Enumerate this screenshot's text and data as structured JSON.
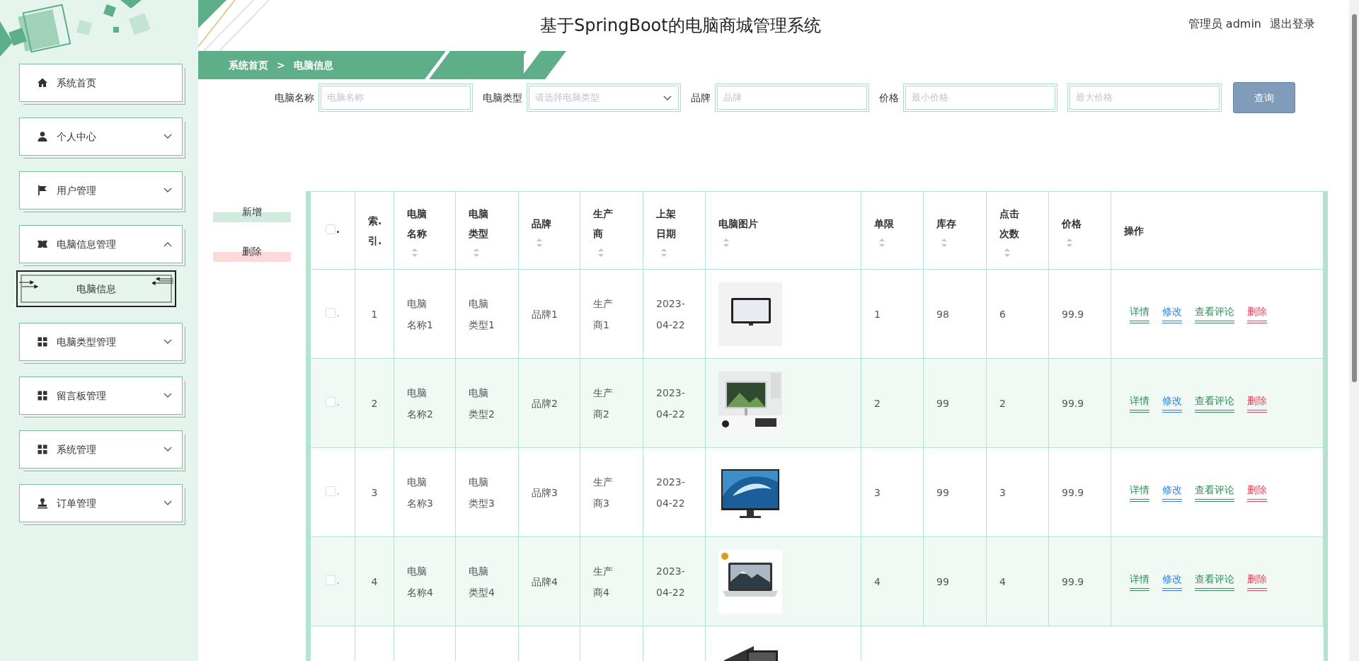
{
  "header": {
    "title": "基于SpringBoot的电脑商城管理系统",
    "user": "管理员 admin",
    "logout": "退出登录"
  },
  "sidebar": {
    "items": [
      {
        "label": "系统首页"
      },
      {
        "label": "个人中心",
        "expanded": false
      },
      {
        "label": "用户管理",
        "expanded": false
      },
      {
        "label": "电脑信息管理",
        "expanded": true,
        "children": [
          {
            "label": "电脑信息",
            "selected": true
          }
        ]
      },
      {
        "label": "电脑类型管理",
        "expanded": false
      },
      {
        "label": "留言板管理",
        "expanded": false
      },
      {
        "label": "系统管理",
        "expanded": false
      },
      {
        "label": "订单管理",
        "expanded": false
      }
    ]
  },
  "breadcrumb": [
    "系统首页",
    ">",
    "电脑信息"
  ],
  "search": {
    "fields": [
      {
        "label": "电脑名称",
        "placeholder": "电脑名称",
        "kind": "text"
      },
      {
        "label": "电脑类型",
        "placeholder": "请选择电脑类型",
        "kind": "select"
      },
      {
        "label": "品牌",
        "placeholder": "品牌",
        "kind": "text"
      },
      {
        "label": "价格",
        "placeholder": "最小价格",
        "kind": "text"
      },
      {
        "placeholder": "最大价格",
        "kind": "text"
      }
    ],
    "button": "查询"
  },
  "actions": [
    {
      "label": "新增",
      "kind": "add"
    },
    {
      "label": "删除",
      "kind": "delete"
    }
  ],
  "table": {
    "checkbox_mark": ".",
    "all_checked": false,
    "columns": [
      {
        "label": "索.引.",
        "sortable": false
      },
      {
        "label": "电脑名称",
        "sortable": true
      },
      {
        "label": "电脑类型",
        "sortable": true
      },
      {
        "label": "品牌",
        "sortable": true
      },
      {
        "label": "生产商",
        "sortable": true
      },
      {
        "label": "上架日期",
        "sortable": true
      },
      {
        "label": "电脑图片",
        "sortable": true
      },
      {
        "label": "单限",
        "sortable": true
      },
      {
        "label": "库存",
        "sortable": true
      },
      {
        "label": "点击次数",
        "sortable": true
      },
      {
        "label": "价格",
        "sortable": true
      },
      {
        "label": "操作",
        "sortable": false
      }
    ],
    "rows": [
      {
        "checked": false,
        "mark": ".",
        "cells": [
          "1",
          "电脑名称1",
          "电脑类型1",
          "品牌1",
          "生产商1",
          "2023-04-22",
          {
            "kind": "picture"
          },
          "1",
          "98",
          "6",
          "99.9"
        ],
        "ops": [
          "详情",
          "修改",
          "查看评论",
          "删除"
        ]
      },
      {
        "checked": false,
        "mark": ".",
        "cells": [
          "2",
          "电脑名称2",
          "电脑类型2",
          "品牌2",
          "生产商2",
          "2023-04-22",
          {
            "kind": "picture"
          },
          "2",
          "99",
          "2",
          "99.9"
        ],
        "ops": [
          "详情",
          "修改",
          "查看评论",
          "删除"
        ]
      },
      {
        "checked": false,
        "mark": ".",
        "cells": [
          "3",
          "电脑名称3",
          "电脑类型3",
          "品牌3",
          "生产商3",
          "2023-04-22",
          {
            "kind": "picture"
          },
          "3",
          "99",
          "3",
          "99.9"
        ],
        "ops": [
          "详情",
          "修改",
          "查看评论",
          "删除"
        ]
      },
      {
        "checked": false,
        "mark": ".",
        "cells": [
          "4",
          "电脑名称4",
          "电脑类型4",
          "品牌4",
          "生产商4",
          "2023-04-22",
          {
            "kind": "picture"
          },
          "4",
          "99",
          "4",
          "99.9"
        ],
        "ops": [
          "详情",
          "修改",
          "查看评论",
          "删除"
        ]
      },
      {
        "cells": [
          "",
          "",
          "",
          "",
          "",
          "",
          {
            "kind": "picture"
          }
        ]
      }
    ]
  }
}
